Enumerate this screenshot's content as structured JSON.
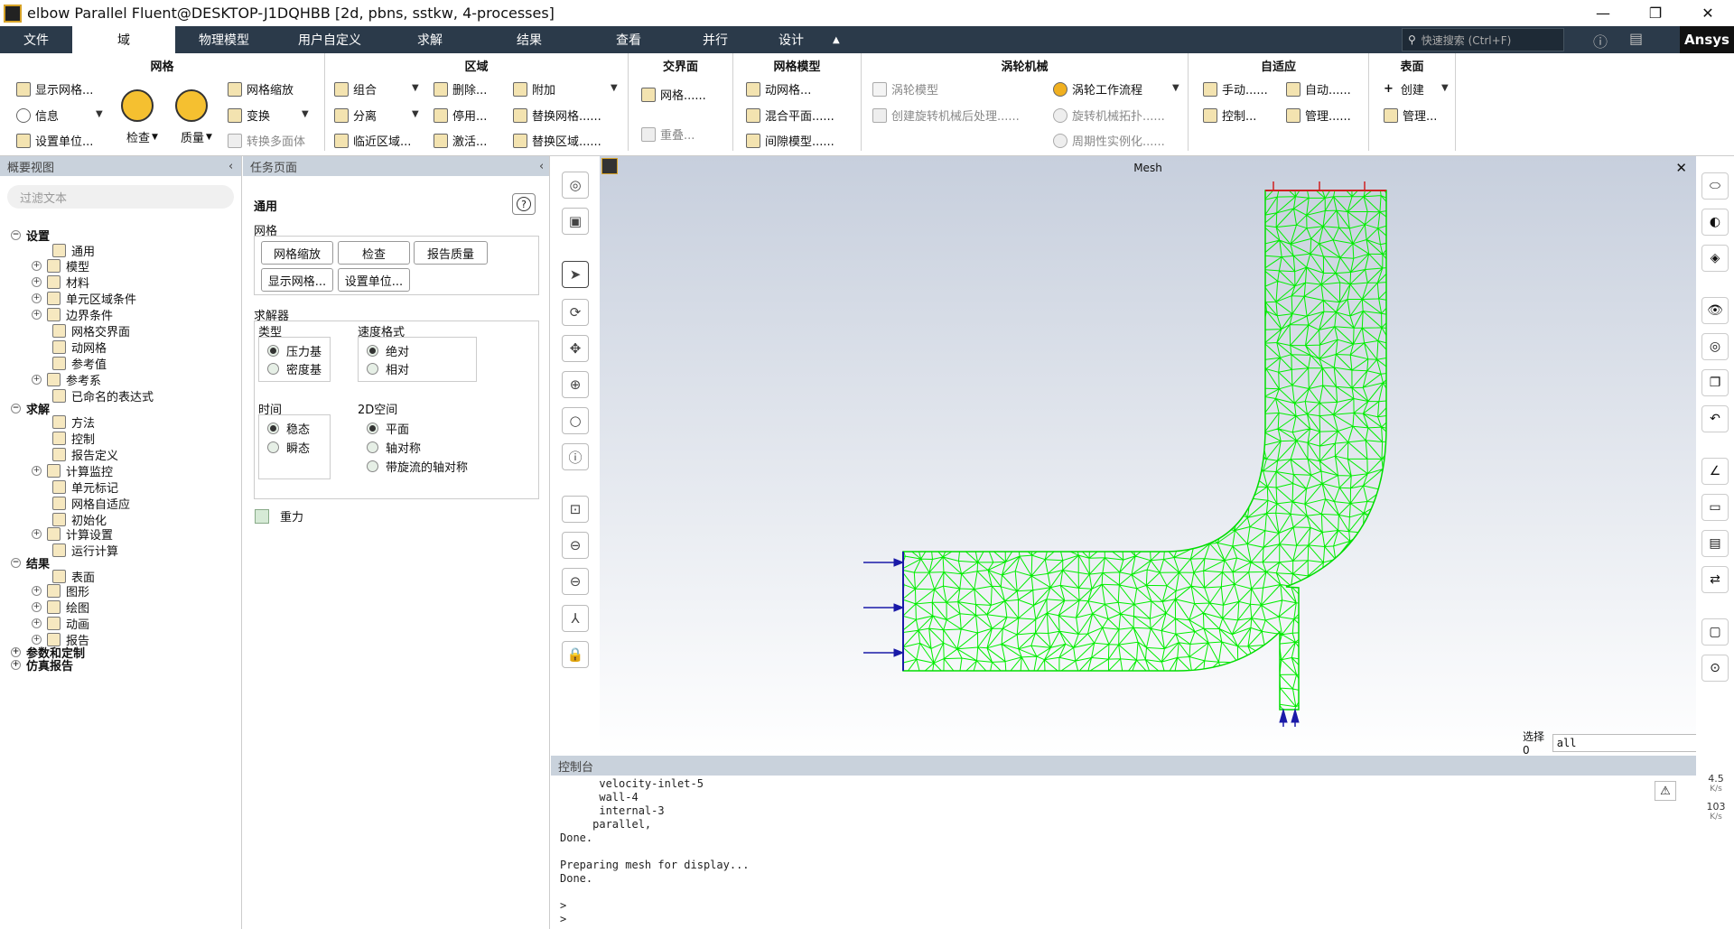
{
  "window": {
    "title": "elbow Parallel Fluent@DESKTOP-J1DQHBB  [2d, pbns, sstkw, 4-processes]",
    "minimize": "—",
    "restore": "❐",
    "close": "✕"
  },
  "menubar": {
    "tabs": [
      "文件",
      "域",
      "物理模型",
      "用户自定义",
      "求解",
      "结果",
      "查看",
      "并行",
      "设计"
    ],
    "collapse": "▲",
    "search_placeholder": "快速搜索 (Ctrl+F)",
    "brand": "Ansys"
  },
  "ribbon": {
    "mesh": {
      "title": "网格",
      "show_mesh": "显示网格...",
      "info": "信息",
      "units": "设置单位...",
      "check": "检查",
      "quality": "质量",
      "scale": "网格缩放",
      "transform": "变换",
      "convert": "转换多面体"
    },
    "zone": {
      "title": "区域",
      "combine": "组合",
      "separate": "分离",
      "adjacency": "临近区域...",
      "delete": "删除...",
      "deactivate": "停用...",
      "activate": "激活...",
      "append": "附加",
      "replace_mesh": "替换网格......",
      "replace_zone": "替换区域......"
    },
    "interface": {
      "title": "交界面",
      "mesh": "网格......",
      "overset": "重叠..."
    },
    "mesh_models": {
      "title": "网格模型",
      "dynamic": "动网格...",
      "mixing_plane": "混合平面......",
      "gap": "间隙模型......"
    },
    "turbo": {
      "title": "涡轮机械",
      "turbo_model": "涡轮模型",
      "postproc": "创建旋转机械后处理......",
      "workflow": "涡轮工作流程",
      "topology": "旋转机械拓扑......",
      "periodic": "周期性实例化......"
    },
    "adapt": {
      "title": "自适应",
      "manual": "手动......",
      "auto": "自动......",
      "control": "控制...",
      "manage": "管理......"
    },
    "surface": {
      "title": "表面",
      "create": "创建",
      "manage": "管理..."
    }
  },
  "tree": {
    "header": "概要视图",
    "filter_placeholder": "过滤文本",
    "setup": "设置",
    "general": "通用",
    "models": "模型",
    "materials": "材料",
    "cell_zones": "单元区域条件",
    "boundary": "边界条件",
    "mesh_interfaces": "网格交界面",
    "dynamic_mesh": "动网格",
    "ref_values": "参考值",
    "ref_frames": "参考系",
    "named_expr": "已命名的表达式",
    "solution": "求解",
    "methods": "方法",
    "controls": "控制",
    "report_defs": "报告定义",
    "monitors": "计算监控",
    "cell_registers": "单元标记",
    "mesh_adapt": "网格自适应",
    "init": "初始化",
    "calc_activities": "计算设置",
    "run_calc": "运行计算",
    "results": "结果",
    "surfaces": "表面",
    "graphics": "图形",
    "plots": "绘图",
    "animations": "动画",
    "reports": "报告",
    "params": "参数和定制",
    "sim_reports": "仿真报告"
  },
  "task": {
    "header": "任务页面",
    "page_title": "通用",
    "help": "?",
    "mesh_label": "网格",
    "btn_scale": "网格缩放",
    "btn_check": "检查",
    "btn_quality": "报告质量",
    "btn_display": "显示网格...",
    "btn_units": "设置单位...",
    "solver_label": "求解器",
    "type_label": "类型",
    "type_pressure": "压力基",
    "type_density": "密度基",
    "velocity_label": "速度格式",
    "vel_absolute": "绝对",
    "vel_relative": "相对",
    "time_label": "时间",
    "time_steady": "稳态",
    "time_transient": "瞬态",
    "space_label": "2D空间",
    "space_planar": "平面",
    "space_axisym": "轴对称",
    "space_swirl": "带旋流的轴对称",
    "gravity": "重力"
  },
  "viewport": {
    "title": "Mesh",
    "close": "✕",
    "select_label": "选择0",
    "select_value": "all"
  },
  "console": {
    "header": "控制台",
    "lines": [
      "      velocity-inlet-5",
      "      wall-4",
      "      internal-3",
      "     parallel,",
      "Done.",
      "",
      "Preparing mesh for display...",
      "Done.",
      "",
      ">",
      ">"
    ]
  },
  "perf": {
    "val1": "4.5",
    "unit1": "K/s",
    "val2": "103",
    "unit2": "K/s"
  },
  "colors": {
    "mesh": "#00ee00",
    "menubar": "#2b3a4a",
    "inlet": "#1a1aa8",
    "wall": "#d02020"
  }
}
